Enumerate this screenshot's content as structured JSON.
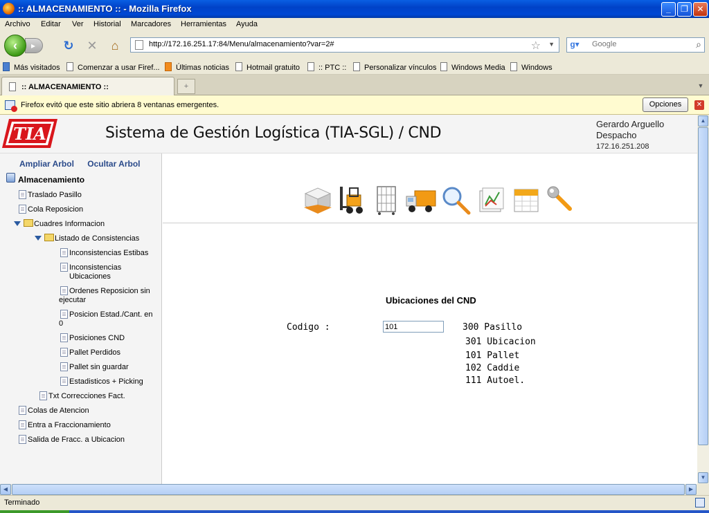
{
  "window": {
    "title": ":: ALMACENAMIENTO :: - Mozilla Firefox"
  },
  "menu": [
    "Archivo",
    "Editar",
    "Ver",
    "Historial",
    "Marcadores",
    "Herramientas",
    "Ayuda"
  ],
  "nav": {
    "url": "http://172.16.251.17:84/Menu/almacenamiento?var=2#",
    "search_placeholder": "Google"
  },
  "bookmarks": [
    "Más visitados",
    "Comenzar a usar Firef...",
    "Últimas noticias",
    "Hotmail gratuito",
    ":: PTC ::",
    "Personalizar vínculos",
    "Windows Media",
    "Windows"
  ],
  "tab": {
    "label": ":: ALMACENAMIENTO ::"
  },
  "notification": {
    "text": "Firefox evitó que este sitio abriera 8 ventanas emergentes.",
    "button": "Opciones"
  },
  "header": {
    "logo_text": "TIA",
    "app_title": "Sistema de Gestión Logística (TIA-SGL) / CND",
    "user_name": "Gerardo Arguello",
    "user_role": "Despacho",
    "user_ip": "172.16.251.208"
  },
  "sidebar": {
    "expand": "Ampliar Arbol",
    "hide": "Ocultar Arbol",
    "root": "Almacenamiento",
    "items": [
      "Traslado Pasillo",
      "Cola Reposicion",
      "Cuadres Informacion",
      "Listado de Consistencias",
      "Inconsistencias Estibas",
      "Inconsistencias Ubicaciones",
      "Ordenes Reposicion sin ejecutar",
      "Posicion Estad./Cant. en 0",
      "Posiciones CND",
      "Pallet Perdidos",
      "Pallet sin guardar",
      "Estadisticos + Picking",
      "Txt Correcciones Fact.",
      "Colas de Atencion",
      "Entra a Fraccionamiento",
      "Salida de Fracc. a Ubicacion"
    ]
  },
  "main": {
    "section_title": "Ubicaciones del CND",
    "codigo_label": "Codigo :",
    "codigo_value": "101",
    "legend": [
      "300 Pasillo",
      "301 Ubicacion",
      "101 Pallet",
      "102 Caddie",
      "111 Autoel."
    ]
  },
  "status": "Terminado"
}
